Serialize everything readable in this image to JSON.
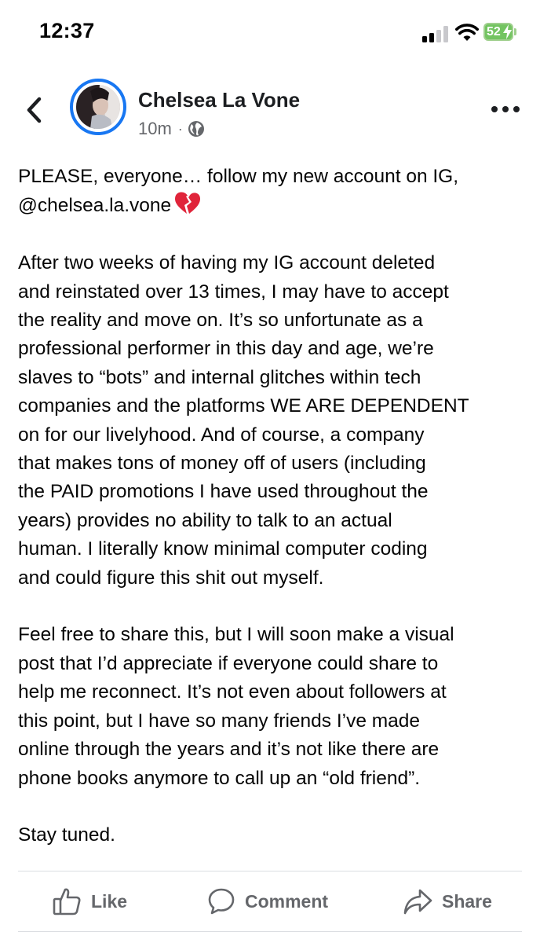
{
  "status_bar": {
    "time": "12:37",
    "battery_level": "52",
    "battery_color": "#73c461"
  },
  "post": {
    "author": "Chelsea La Vone",
    "timestamp": "10m",
    "audience_icon": "globe-icon",
    "paragraphs": [
      "PLEASE, everyone… follow my new account on IG,\n@chelsea.la.vone",
      "After two weeks of having my IG account deleted\nand reinstated over 13 times, I may have to accept\nthe reality and move on. It’s so unfortunate as a\nprofessional performer in this day and age, we’re\nslaves to “bots” and internal glitches within tech\ncompanies and the platforms WE ARE DEPENDENT\non for our livelyhood. And of course, a company\nthat makes tons of money off of users (including\nthe PAID promotions I have used throughout the\nyears) provides no ability to talk to an actual\nhuman. I literally know minimal computer coding\nand could figure this shit out myself.",
      "Feel free to share this, but I will soon make a visual\npost that I’d appreciate if everyone could share to\nhelp me reconnect. It’s not even about followers at\nthis point, but I have so many friends I’ve made\nonline through the years and it’s not like there are\nphone books anymore to call up an “old friend”.",
      "Stay tuned."
    ]
  },
  "actions": {
    "like": "Like",
    "comment": "Comment",
    "share": "Share"
  },
  "colors": {
    "accent": "#1877f2",
    "secondary_text": "#65676b"
  }
}
